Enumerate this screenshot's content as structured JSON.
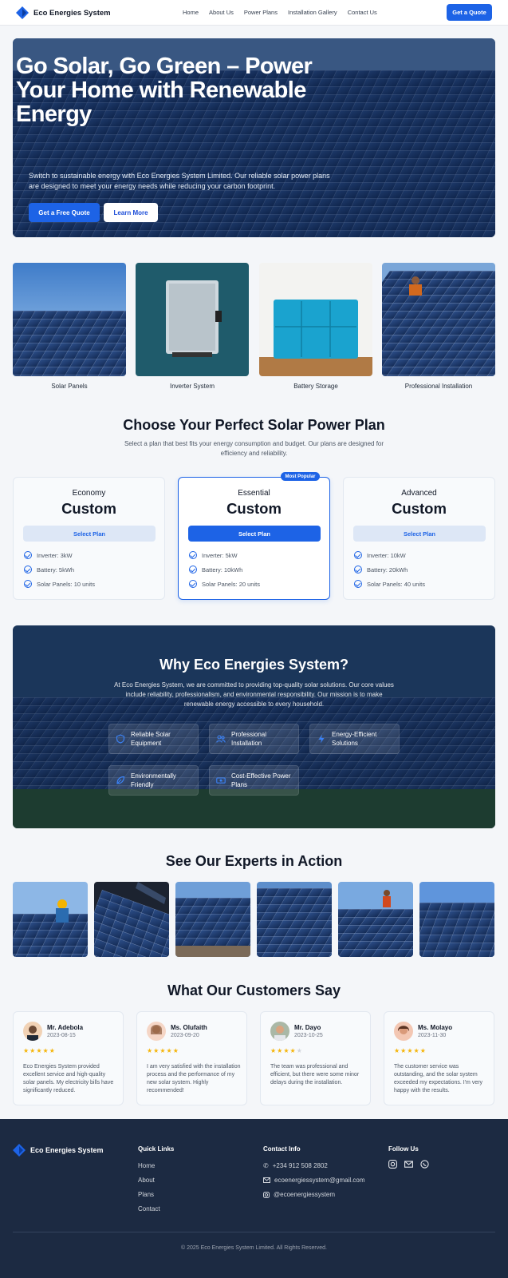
{
  "header": {
    "brand": "Eco Energies System",
    "nav": [
      "Home",
      "About Us",
      "Power Plans",
      "Installation Gallery",
      "Contact Us"
    ],
    "cta": "Get a Quote"
  },
  "hero": {
    "title": "Go Solar, Go Green – Power Your Home with Renewable Energy",
    "subtitle": "Switch to sustainable energy with Eco Energies System Limited. Our reliable solar power plans are designed to meet your energy needs while reducing your carbon footprint.",
    "primary_button": "Get a Free Quote",
    "secondary_button": "Learn More"
  },
  "products": [
    "Solar Panels",
    "Inverter System",
    "Battery Storage",
    "Professional Installation"
  ],
  "plans": {
    "title": "Choose Your Perfect Solar Power Plan",
    "subtitle": "Select a plan that best fits your energy consumption and budget. Our plans are designed for efficiency and reliability.",
    "badge": "Most Popular",
    "items": [
      {
        "name": "Economy",
        "price": "Custom",
        "button": "Select Plan",
        "features": [
          "Inverter: 3kW",
          "Battery: 5kWh",
          "Solar Panels: 10 units"
        ]
      },
      {
        "name": "Essential",
        "price": "Custom",
        "button": "Select Plan",
        "features": [
          "Inverter: 5kW",
          "Battery: 10kWh",
          "Solar Panels: 20 units"
        ]
      },
      {
        "name": "Advanced",
        "price": "Custom",
        "button": "Select Plan",
        "features": [
          "Inverter: 10kW",
          "Battery: 20kWh",
          "Solar Panels: 40 units"
        ]
      }
    ]
  },
  "why": {
    "title": "Why Eco Energies System?",
    "subtitle": "At Eco Energies System, we are committed to providing top-quality solar solutions. Our core values include reliability, professionalism, and environmental responsibility. Our mission is to make renewable energy accessible to every household.",
    "features": [
      {
        "label": "Reliable Solar Equipment",
        "icon": "shield-icon"
      },
      {
        "label": "Professional Installation",
        "icon": "users-icon"
      },
      {
        "label": "Energy-Efficient Solutions",
        "icon": "lightning-icon"
      },
      {
        "label": "Environmentally Friendly",
        "icon": "leaf-icon"
      },
      {
        "label": "Cost-Effective Power Plans",
        "icon": "money-icon"
      }
    ]
  },
  "experts": {
    "title": "See Our Experts in Action"
  },
  "reviews": {
    "title": "What Our Customers Say",
    "items": [
      {
        "name": "Mr. Adebola",
        "date": "2023-08-15",
        "rating": 5,
        "text": "Eco Energies System provided excellent service and high-quality solar panels. My electricity bills have significantly reduced."
      },
      {
        "name": "Ms. Olufaith",
        "date": "2023-09-20",
        "rating": 5,
        "text": "I am very satisfied with the installation process and the performance of my new solar system. Highly recommended!"
      },
      {
        "name": "Mr. Dayo",
        "date": "2023-10-25",
        "rating": 4,
        "text": "The team was professional and efficient, but there were some minor delays during the installation."
      },
      {
        "name": "Ms. Molayo",
        "date": "2023-11-30",
        "rating": 5,
        "text": "The customer service was outstanding, and the solar system exceeded my expectations. I'm very happy with the results."
      }
    ]
  },
  "footer": {
    "brand": "Eco Energies System",
    "quick_links_title": "Quick Links",
    "quick_links": [
      "Home",
      "About",
      "Plans",
      "Contact"
    ],
    "contact_title": "Contact Info",
    "phone": "+234 912 508 2802",
    "email": "ecoenergiessystem@gmail.com",
    "instagram": "@ecoenergiessystem",
    "follow_title": "Follow Us",
    "copyright": "© 2025 Eco Energies System Limited. All Rights Reserved."
  },
  "colors": {
    "accent": "#1d63e6",
    "footer_bg": "#1c2a42",
    "star": "#f5b50a"
  }
}
